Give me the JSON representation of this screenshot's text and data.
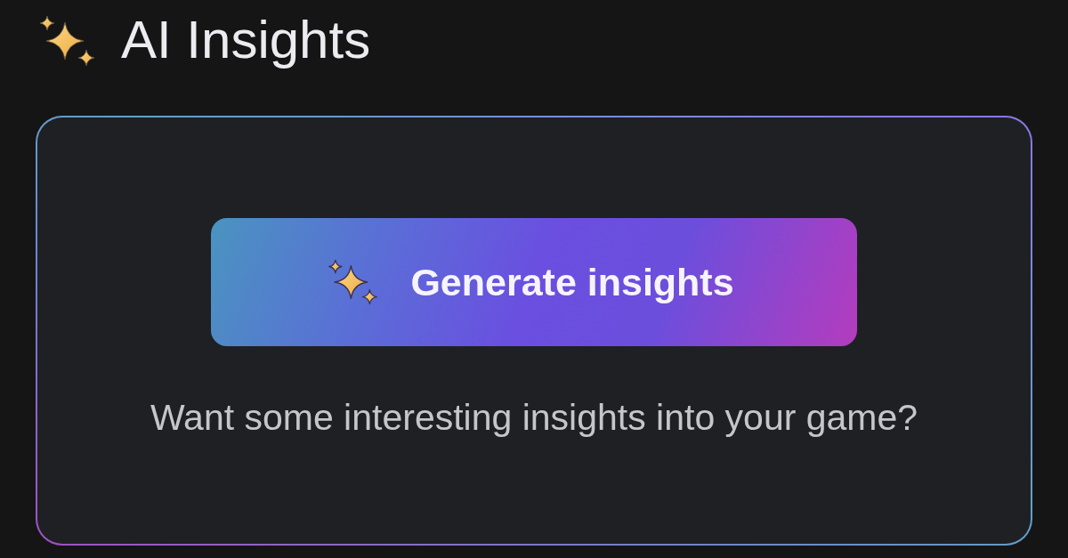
{
  "header": {
    "title": "AI Insights"
  },
  "card": {
    "button": {
      "label": "Generate insights"
    },
    "prompt": "Want some interesting insights into your game?"
  }
}
